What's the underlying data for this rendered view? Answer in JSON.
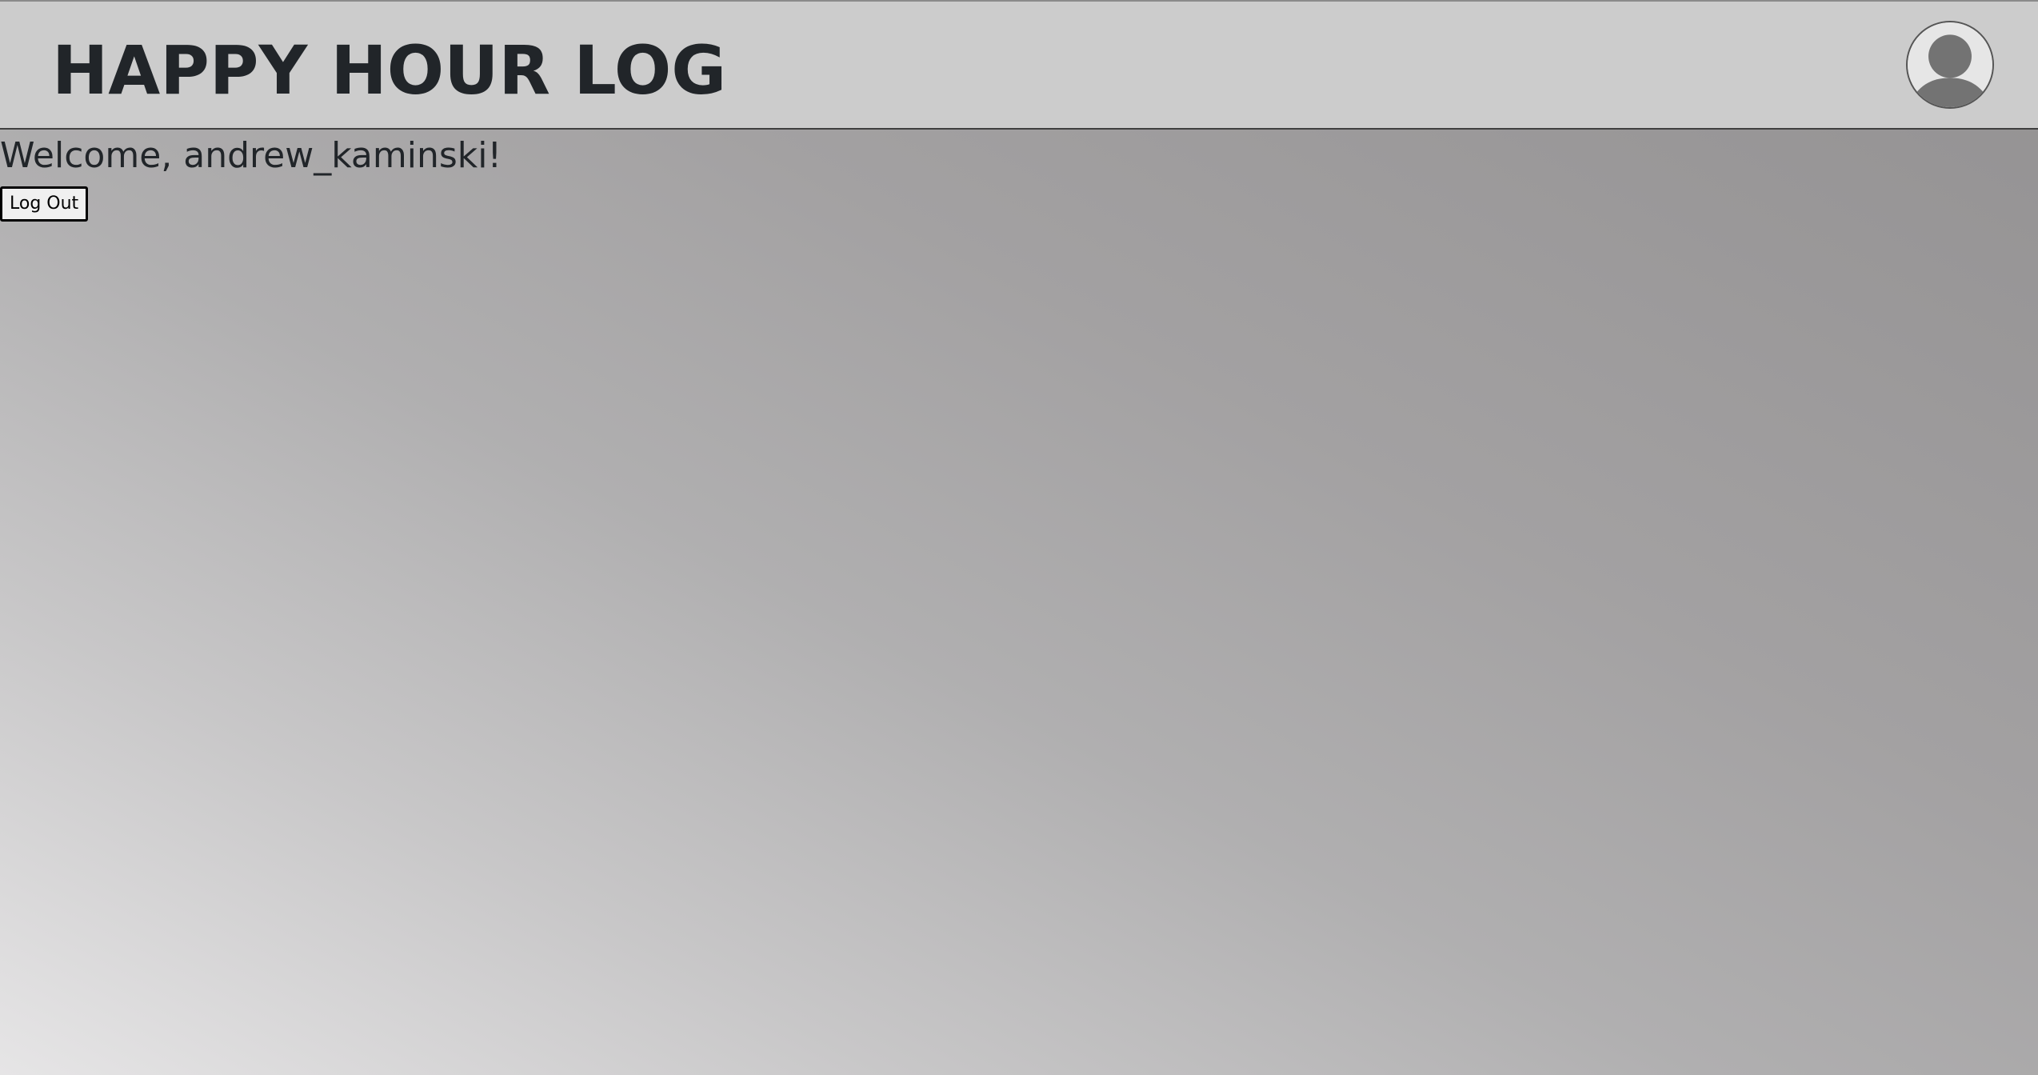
{
  "header": {
    "title": "HAPPY HOUR LOG",
    "avatar_icon": "user-avatar-icon"
  },
  "main": {
    "welcome_text": "Welcome, andrew_kaminski!",
    "logout_label": "Log Out"
  },
  "colors": {
    "header_background": "#cccccc",
    "text": "#212529",
    "avatar_figure": "#737373",
    "avatar_background": "#e6e6e6"
  }
}
